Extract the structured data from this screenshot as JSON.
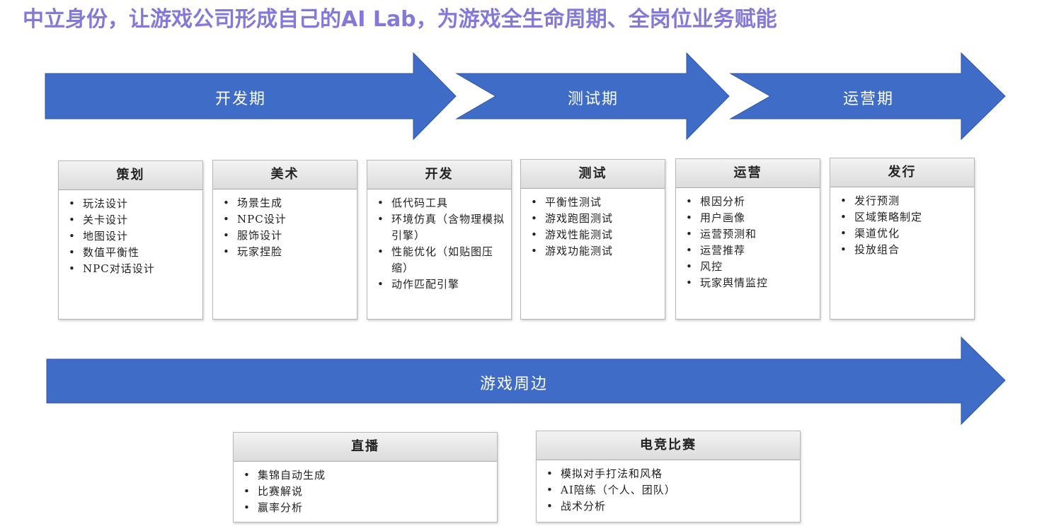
{
  "title": "中立身份，让游戏公司形成自己的AI Lab，为游戏全生命周期、全岗位业务赋能",
  "colors": {
    "title": "#8478d8",
    "arrow": "#3f6cc7",
    "arrow_edge": "#2f55a8"
  },
  "phases": [
    {
      "label": "开发期"
    },
    {
      "label": "测试期"
    },
    {
      "label": "运营期"
    }
  ],
  "cards": [
    {
      "title": "策划",
      "items": [
        "玩法设计",
        "关卡设计",
        "地图设计",
        "数值平衡性",
        "NPC对话设计"
      ]
    },
    {
      "title": "美术",
      "items": [
        "场景生成",
        "NPC设计",
        "服饰设计",
        "玩家捏脸"
      ]
    },
    {
      "title": "开发",
      "items": [
        "低代码工具",
        "环境仿真（含物理模拟引擎）",
        "性能优化（如贴图压缩）",
        "动作匹配引擎"
      ]
    },
    {
      "title": "测试",
      "items": [
        "平衡性测试",
        "游戏跑图测试",
        "游戏性能测试",
        "游戏功能测试"
      ]
    },
    {
      "title": "运营",
      "items": [
        "根因分析",
        "用户画像",
        "运营预测和",
        "运营推荐",
        "风控",
        "玩家舆情监控"
      ]
    },
    {
      "title": "发行",
      "items": [
        "发行预测",
        "区域策略制定",
        "渠道优化",
        "投放组合"
      ]
    }
  ],
  "periphery": {
    "label": "游戏周边"
  },
  "bottom_cards": [
    {
      "title": "直播",
      "items": [
        "集锦自动生成",
        "比赛解说",
        "赢率分析"
      ]
    },
    {
      "title": "电竞比赛",
      "items": [
        "模拟对手打法和风格",
        "AI陪练（个人、团队）",
        "战术分析"
      ]
    }
  ]
}
